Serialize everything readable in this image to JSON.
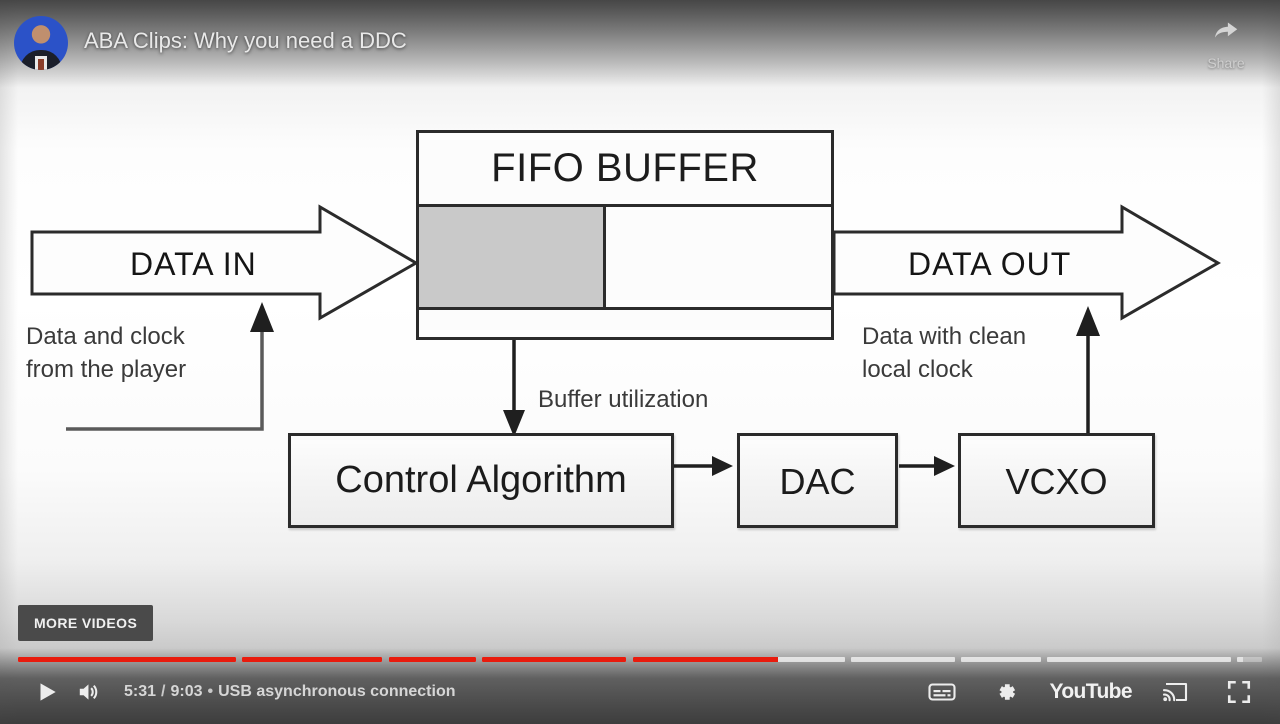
{
  "header": {
    "title": "ABA Clips: Why you need a DDC",
    "avatar_name": "channel-avatar",
    "share_label": "Share",
    "share_icon": "share-arrow-icon"
  },
  "overlay": {
    "more_videos_label": "MORE VIDEOS"
  },
  "controls": {
    "play_icon": "play-icon",
    "volume_icon": "volume-on-icon",
    "current_time": "5:31",
    "total_time": "9:03",
    "separator": "/",
    "chapter_bullet": "•",
    "chapter_title": "USB asynchronous connection",
    "subtitles_icon": "subtitles-icon",
    "settings_icon": "gear-icon",
    "youtube_wordmark": "YouTube",
    "cast_icon": "cast-icon",
    "fullscreen_icon": "fullscreen-icon"
  },
  "progress": {
    "played_fraction": 0.611,
    "loaded_fraction": 0.985,
    "chapters": [
      {
        "start": 0.0,
        "end": 0.175
      },
      {
        "start": 0.18,
        "end": 0.293
      },
      {
        "start": 0.298,
        "end": 0.368
      },
      {
        "start": 0.373,
        "end": 0.489
      },
      {
        "start": 0.494,
        "end": 0.665
      },
      {
        "start": 0.67,
        "end": 0.753
      },
      {
        "start": 0.758,
        "end": 0.822
      },
      {
        "start": 0.827,
        "end": 0.975
      },
      {
        "start": 0.98,
        "end": 1.0
      }
    ]
  },
  "diagram": {
    "fifo_title": "FIFO BUFFER",
    "data_in_label": "DATA IN",
    "data_out_label": "DATA OUT",
    "control_box_label": "Control Algorithm",
    "dac_box_label": "DAC",
    "vcxo_box_label": "VCXO",
    "buffer_utilization_label": "Buffer utilization",
    "left_annotation": "Data and clock\nfrom the player",
    "right_annotation": "Data with clean\nlocal clock",
    "fifo_fill_fraction": 0.455,
    "colors": {
      "stroke": "#2b2b2b",
      "fill_gray": "#c9c9c9",
      "box_fill": "#fcfcfc",
      "accent_red": "#e81b0d"
    }
  }
}
